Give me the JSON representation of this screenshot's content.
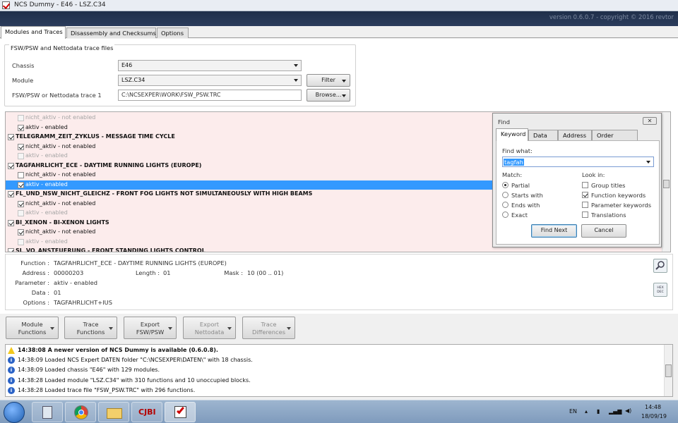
{
  "window": {
    "title": "NCS Dummy - E46 - LSZ.C34",
    "version": "version 0.6.0.7 - copyright © 2016 revtor"
  },
  "tabs": [
    "Modules and Traces",
    "Disassembly and Checksums",
    "Options"
  ],
  "group": {
    "legend": "FSW/PSW and Nettodata trace files",
    "chassis_label": "Chassis",
    "chassis_value": "E46",
    "module_label": "Module",
    "module_value": "LSZ.C34",
    "trace_label": "FSW/PSW or Nettodata trace 1",
    "trace_value": "C:\\NCSEXPER\\WORK\\FSW_PSW.TRC",
    "filter_button": "Filter",
    "browse_button": "Browse..."
  },
  "list": [
    {
      "text": "nicht_aktiv  -  not enabled",
      "checked": false,
      "disabled": true,
      "bold": false,
      "selected": false
    },
    {
      "text": "aktiv  -  enabled",
      "checked": true,
      "disabled": false,
      "bold": false,
      "selected": false
    },
    {
      "text": "TELEGRAMM_ZEIT_ZYKLUS  -  MESSAGE TIME CYCLE",
      "checked": true,
      "disabled": false,
      "bold": true,
      "selected": false
    },
    {
      "text": "nicht_aktiv  -  not enabled",
      "checked": true,
      "disabled": false,
      "bold": false,
      "selected": false
    },
    {
      "text": "aktiv  -  enabled",
      "checked": false,
      "disabled": true,
      "bold": false,
      "selected": false
    },
    {
      "text": "TAGFAHRLICHT_ECE  -  DAYTIME RUNNING LIGHTS (EUROPE)",
      "checked": true,
      "disabled": false,
      "bold": true,
      "selected": false
    },
    {
      "text": "nicht_aktiv  -  not enabled",
      "checked": false,
      "disabled": false,
      "bold": false,
      "selected": false
    },
    {
      "text": "aktiv  -  enabled",
      "checked": true,
      "disabled": false,
      "bold": false,
      "selected": true
    },
    {
      "text": "FL_UND_NSW_NICHT_GLEICHZ  -  FRONT FOG LIGHTS NOT SIMULTANEOUSLY WITH HIGH BEAMS",
      "checked": true,
      "disabled": false,
      "bold": true,
      "selected": false
    },
    {
      "text": "nicht_aktiv  -  not enabled",
      "checked": true,
      "disabled": false,
      "bold": false,
      "selected": false
    },
    {
      "text": "aktiv  -  enabled",
      "checked": false,
      "disabled": true,
      "bold": false,
      "selected": false
    },
    {
      "text": "BI_XENON  -  BI-XENON LIGHTS",
      "checked": true,
      "disabled": false,
      "bold": true,
      "selected": false
    },
    {
      "text": "nicht_aktiv  -  not enabled",
      "checked": true,
      "disabled": false,
      "bold": false,
      "selected": false
    },
    {
      "text": "aktiv  -  enabled",
      "checked": false,
      "disabled": true,
      "bold": false,
      "selected": false
    },
    {
      "text": "SL_VO_ANSTEUERUNG  -  FRONT STANDING LIGHTS CONTROL",
      "checked": true,
      "disabled": false,
      "bold": true,
      "selected": false
    }
  ],
  "details": {
    "function_label": "Function :",
    "function_value": "TAGFAHRLICHT_ECE  -  DAYTIME RUNNING LIGHTS (EUROPE)",
    "address_label": "Address :",
    "address_value": "00000203",
    "length_label": "Length :",
    "length_value": "01",
    "mask_label": "Mask :",
    "mask_value": "10  (00 .. 01)",
    "parameter_label": "Parameter :",
    "parameter_value": "aktiv  -  enabled",
    "data_label": "Data :",
    "data_value": "01",
    "options_label": "Options :",
    "options_value": "TAGFAHRLICHT+IUS",
    "hex_label": "HEX DEC"
  },
  "find": {
    "title": "Find",
    "close": "✕",
    "tabs": [
      "Keyword",
      "Data",
      "Address",
      "Order option"
    ],
    "find_what_label": "Find what:",
    "find_what_value": "tagfah",
    "match_label": "Match:",
    "look_in_label": "Look in:",
    "match_options": [
      {
        "label": "Partial",
        "on": true
      },
      {
        "label": "Starts with",
        "on": false
      },
      {
        "label": "Ends with",
        "on": false
      },
      {
        "label": "Exact",
        "on": false
      }
    ],
    "look_in_options": [
      {
        "label": "Group titles",
        "on": false
      },
      {
        "label": "Function keywords",
        "on": true
      },
      {
        "label": "Parameter keywords",
        "on": false
      },
      {
        "label": "Translations",
        "on": false
      }
    ],
    "find_next": "Find Next",
    "cancel": "Cancel"
  },
  "bottom_buttons": [
    {
      "line1": "Module",
      "line2": "Functions",
      "enabled": true
    },
    {
      "line1": "Trace",
      "line2": "Functions",
      "enabled": true
    },
    {
      "line1": "Export",
      "line2": "FSW/PSW",
      "enabled": true
    },
    {
      "line1": "Export",
      "line2": "Nettodata",
      "enabled": false
    },
    {
      "line1": "Trace",
      "line2": "Differences",
      "enabled": false
    }
  ],
  "log": [
    {
      "text": "14:38:08  A newer version of NCS Dummy is available (0.6.0.8).",
      "type": "warning"
    },
    {
      "text": "14:38:09  Loaded NCS Expert DATEN folder \"C:\\NCSEXPER\\DATEN\\\" with 18 chassis.",
      "type": "info"
    },
    {
      "text": "14:38:09  Loaded chassis \"E46\" with 129 modules.",
      "type": "info"
    },
    {
      "text": "14:38:28  Loaded module \"LSZ.C34\" with 310 functions and 10 unoccupied blocks.",
      "type": "info"
    },
    {
      "text": "14:38:28  Loaded trace file \"FSW_PSW.TRC\" with 296 functions.",
      "type": "info"
    }
  ],
  "taskbar": {
    "lang": "EN",
    "time": "14:48",
    "date": "18/09/19",
    "app_label": "CJBI"
  }
}
